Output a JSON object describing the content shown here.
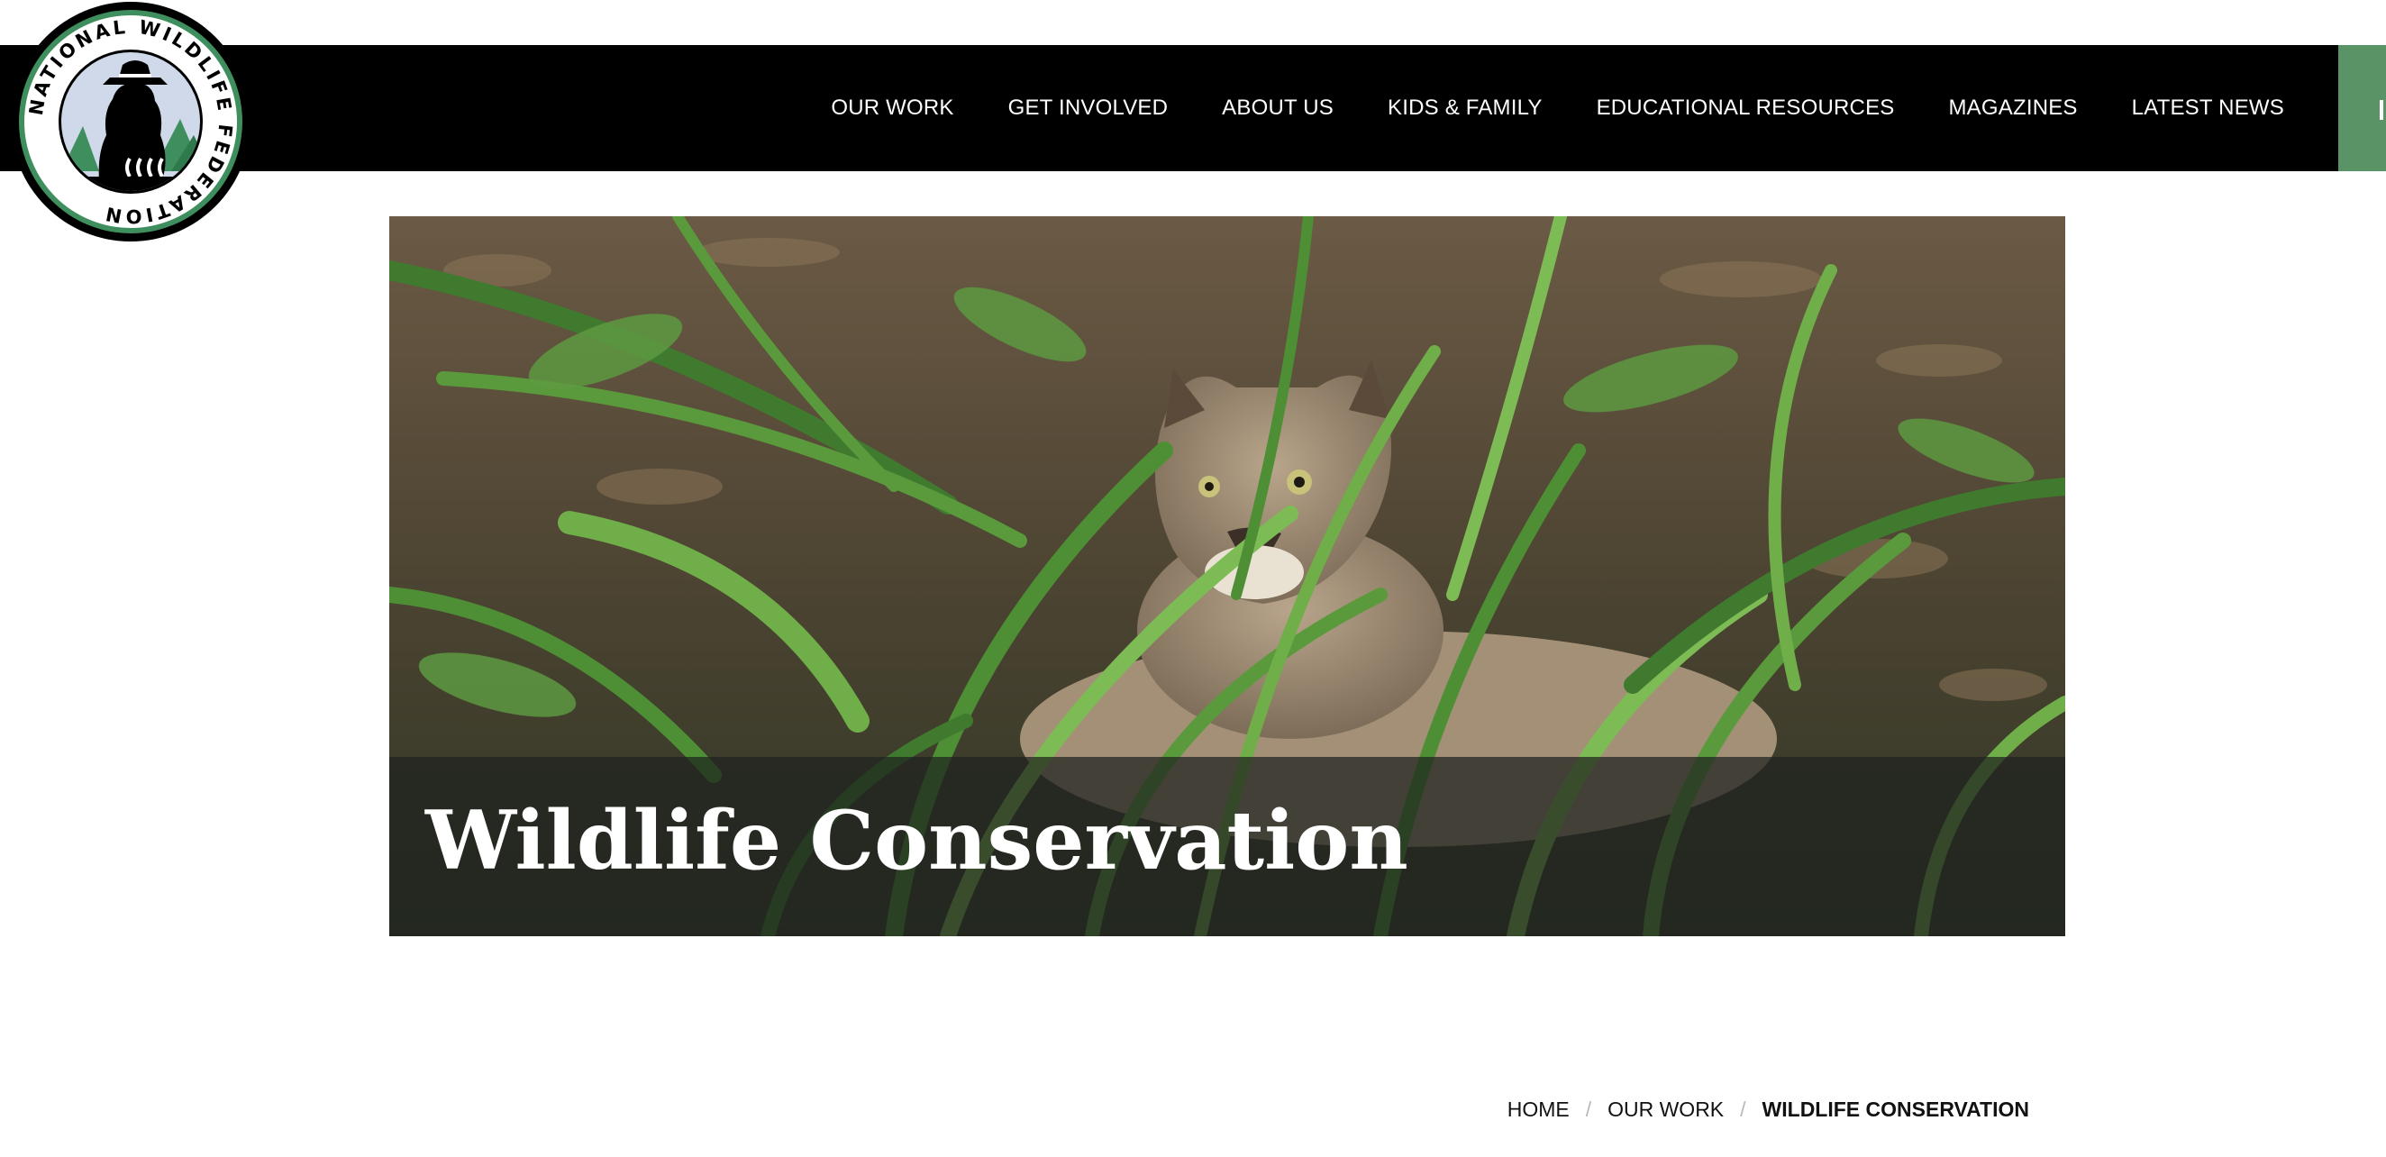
{
  "header": {
    "logo": {
      "ring_text": "NATIONAL WILDLIFE FEDERATION",
      "icon": "ranger-rick-raccoon-logo"
    },
    "nav": [
      {
        "label": "OUR WORK"
      },
      {
        "label": "GET INVOLVED"
      },
      {
        "label": "ABOUT US"
      },
      {
        "label": "KIDS & FAMILY"
      },
      {
        "label": "EDUCATIONAL RESOURCES"
      },
      {
        "label": "MAGAZINES"
      },
      {
        "label": "LATEST NEWS"
      }
    ]
  },
  "hero": {
    "title": "Wildlife Conservation",
    "image": "panther-in-grass-photo"
  },
  "breadcrumb": {
    "items": [
      {
        "label": "HOME"
      },
      {
        "label": "OUR WORK"
      }
    ],
    "separator": "/",
    "current": "WILDLIFE CONSERVATION"
  },
  "colors": {
    "navbar": "#000000",
    "accent_green": "#5a9466",
    "logo_green": "#3f8f5e",
    "logo_sky": "#cfd9ea",
    "caption_overlay": "#1e221e"
  }
}
